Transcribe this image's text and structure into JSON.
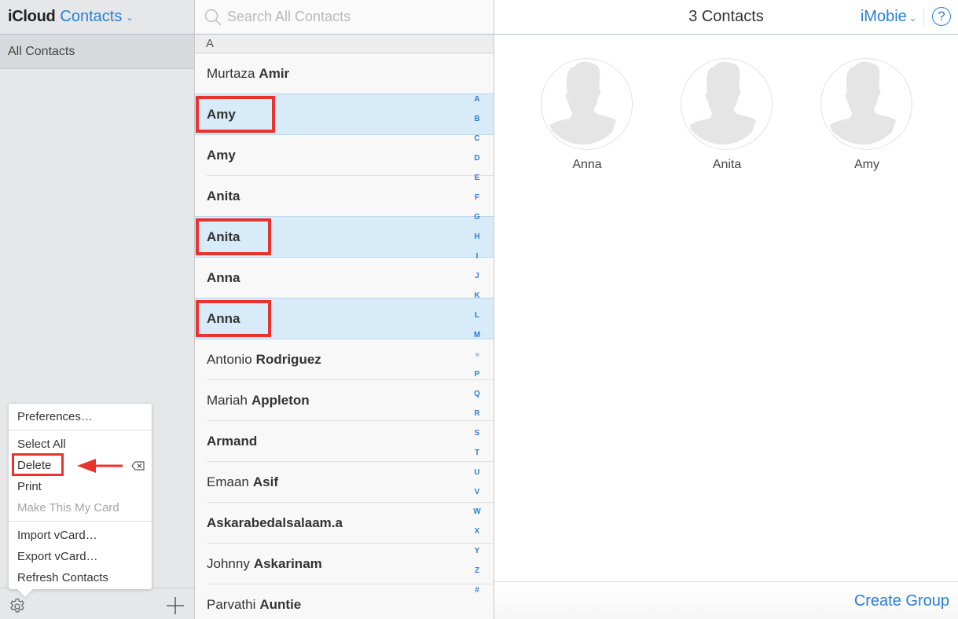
{
  "sidebar": {
    "brand": "iCloud",
    "app_name": "Contacts",
    "groups": [
      {
        "label": "All Contacts",
        "selected": true
      }
    ]
  },
  "menu": {
    "items": [
      {
        "label": "Preferences…",
        "enabled": true
      },
      {
        "label": "Select All",
        "enabled": true
      },
      {
        "label": "Delete",
        "enabled": true,
        "shortcut": "delete-key-icon",
        "highlighted": true
      },
      {
        "label": "Print",
        "enabled": true
      },
      {
        "label": "Make This My Card",
        "enabled": false
      },
      {
        "label": "Import vCard…",
        "enabled": true
      },
      {
        "label": "Export vCard…",
        "enabled": true
      },
      {
        "label": "Refresh Contacts",
        "enabled": true
      }
    ]
  },
  "search": {
    "placeholder": "Search All Contacts"
  },
  "list": {
    "section": "A",
    "contacts": [
      {
        "first": "Murtaza",
        "last": "Amir",
        "selected": false,
        "highlighted": false
      },
      {
        "first": "",
        "last": "Amy",
        "selected": true,
        "highlighted": true
      },
      {
        "first": "",
        "last": "Amy",
        "selected": false,
        "highlighted": false
      },
      {
        "first": "",
        "last": "Anita",
        "selected": false,
        "highlighted": false
      },
      {
        "first": "",
        "last": "Anita",
        "selected": true,
        "highlighted": true
      },
      {
        "first": "",
        "last": "Anna",
        "selected": false,
        "highlighted": false
      },
      {
        "first": "",
        "last": "Anna",
        "selected": true,
        "highlighted": true
      },
      {
        "first": "Antonio",
        "last": "Rodriguez",
        "selected": false,
        "highlighted": false
      },
      {
        "first": "Mariah",
        "last": "Appleton",
        "selected": false,
        "highlighted": false
      },
      {
        "first": "",
        "last": "Armand",
        "selected": false,
        "highlighted": false
      },
      {
        "first": "Emaan",
        "last": "Asif",
        "selected": false,
        "highlighted": false
      },
      {
        "first": "",
        "last": "Askarabedalsalaam.a",
        "selected": false,
        "highlighted": false
      },
      {
        "first": "Johnny",
        "last": "Askarinam",
        "selected": false,
        "highlighted": false
      },
      {
        "first": "Parvathi",
        "last": "Auntie",
        "selected": false,
        "highlighted": false
      }
    ],
    "index": [
      "A",
      "B",
      "C",
      "D",
      "E",
      "F",
      "G",
      "H",
      "I",
      "J",
      "K",
      "L",
      "M",
      "•",
      "P",
      "Q",
      "R",
      "S",
      "T",
      "U",
      "V",
      "W",
      "X",
      "Y",
      "Z",
      "#"
    ]
  },
  "detail": {
    "title": "3 Contacts",
    "account": "iMobie",
    "help": "?",
    "cards": [
      {
        "name": "Anna"
      },
      {
        "name": "Anita"
      },
      {
        "name": "Amy"
      }
    ],
    "create_group": "Create Group"
  },
  "colors": {
    "accent": "#2a7fd4",
    "selection": "#d7ebf9",
    "annotation": "#e8332f"
  }
}
